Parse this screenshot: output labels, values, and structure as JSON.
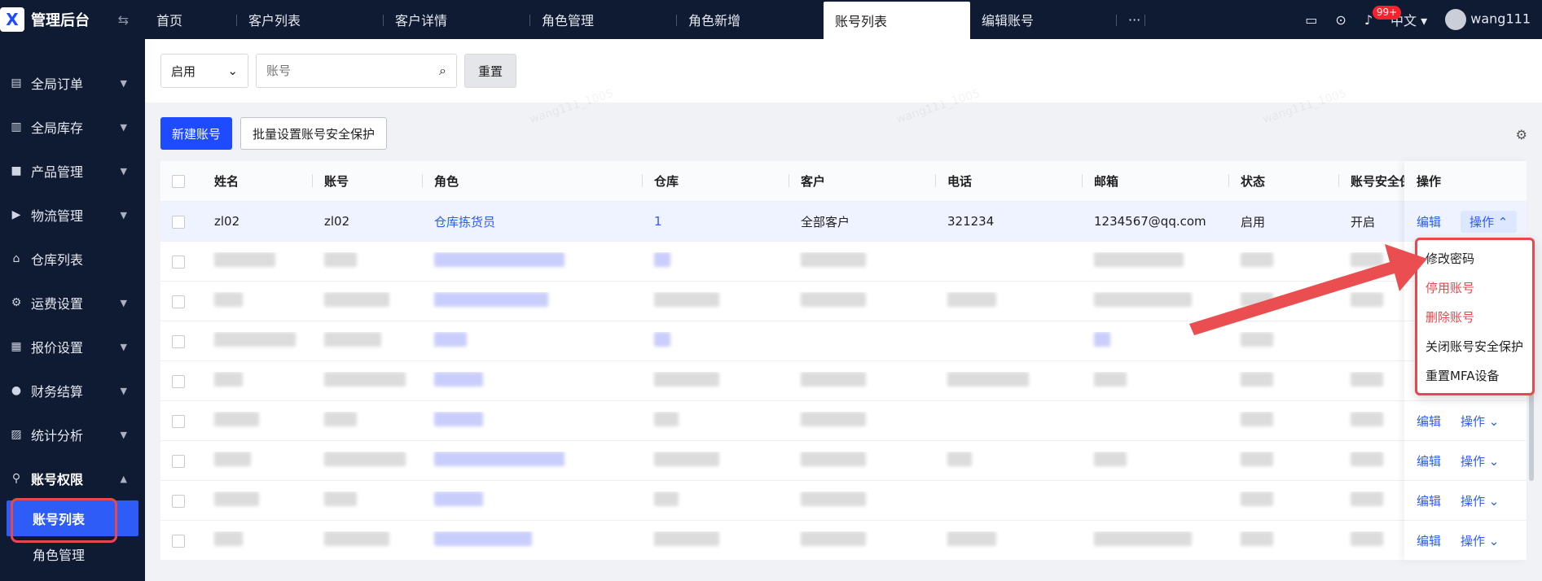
{
  "app": {
    "title": "管理后台",
    "logo_letter": "X"
  },
  "sidebar": {
    "items": [
      {
        "label": "全局订单",
        "icon": "clipboard-icon"
      },
      {
        "label": "全局库存",
        "icon": "warehouse-icon"
      },
      {
        "label": "产品管理",
        "icon": "box-icon"
      },
      {
        "label": "物流管理",
        "icon": "truck-icon"
      },
      {
        "label": "仓库列表",
        "icon": "home-icon"
      },
      {
        "label": "运费设置",
        "icon": "gear-icon"
      },
      {
        "label": "报价设置",
        "icon": "document-icon"
      },
      {
        "label": "财务结算",
        "icon": "coin-icon"
      },
      {
        "label": "统计分析",
        "icon": "chart-icon"
      },
      {
        "label": "账号权限",
        "icon": "org-icon"
      }
    ],
    "sub_items": [
      {
        "label": "账号列表"
      },
      {
        "label": "角色管理"
      }
    ]
  },
  "tabs": [
    {
      "label": "首页"
    },
    {
      "label": "客户列表"
    },
    {
      "label": "客户详情"
    },
    {
      "label": "角色管理"
    },
    {
      "label": "角色新增"
    },
    {
      "label": "账号列表"
    },
    {
      "label": "编辑账号"
    },
    {
      "label": "···"
    }
  ],
  "header": {
    "badge": "99+",
    "language": "中文",
    "username": "wang111"
  },
  "filter": {
    "status": "启用",
    "account_placeholder": "账号",
    "reset_label": "重置"
  },
  "toolbar": {
    "new_label": "新建账号",
    "batch_label": "批量设置账号安全保护"
  },
  "table": {
    "columns": [
      "姓名",
      "账号",
      "角色",
      "仓库",
      "客户",
      "电话",
      "邮箱",
      "状态",
      "账号安全保",
      "操作"
    ],
    "first_row": {
      "name": "zl02",
      "account": "zl02",
      "role": "仓库拣货员",
      "warehouse": "1",
      "customer": "全部客户",
      "phone": "321234",
      "email": "1234567@qq.com",
      "status": "启用",
      "security": "开启"
    },
    "edit_label": "编辑",
    "op_label": "操作"
  },
  "menu": {
    "items": [
      "修改密码",
      "停用账号",
      "删除账号",
      "关闭账号安全保护",
      "重置MFA设备"
    ]
  },
  "watermark": "wang111_1005",
  "colors": {
    "primary": "#1f4bff",
    "sidebar_bg": "#0f1a33",
    "danger": "#e8474d"
  }
}
